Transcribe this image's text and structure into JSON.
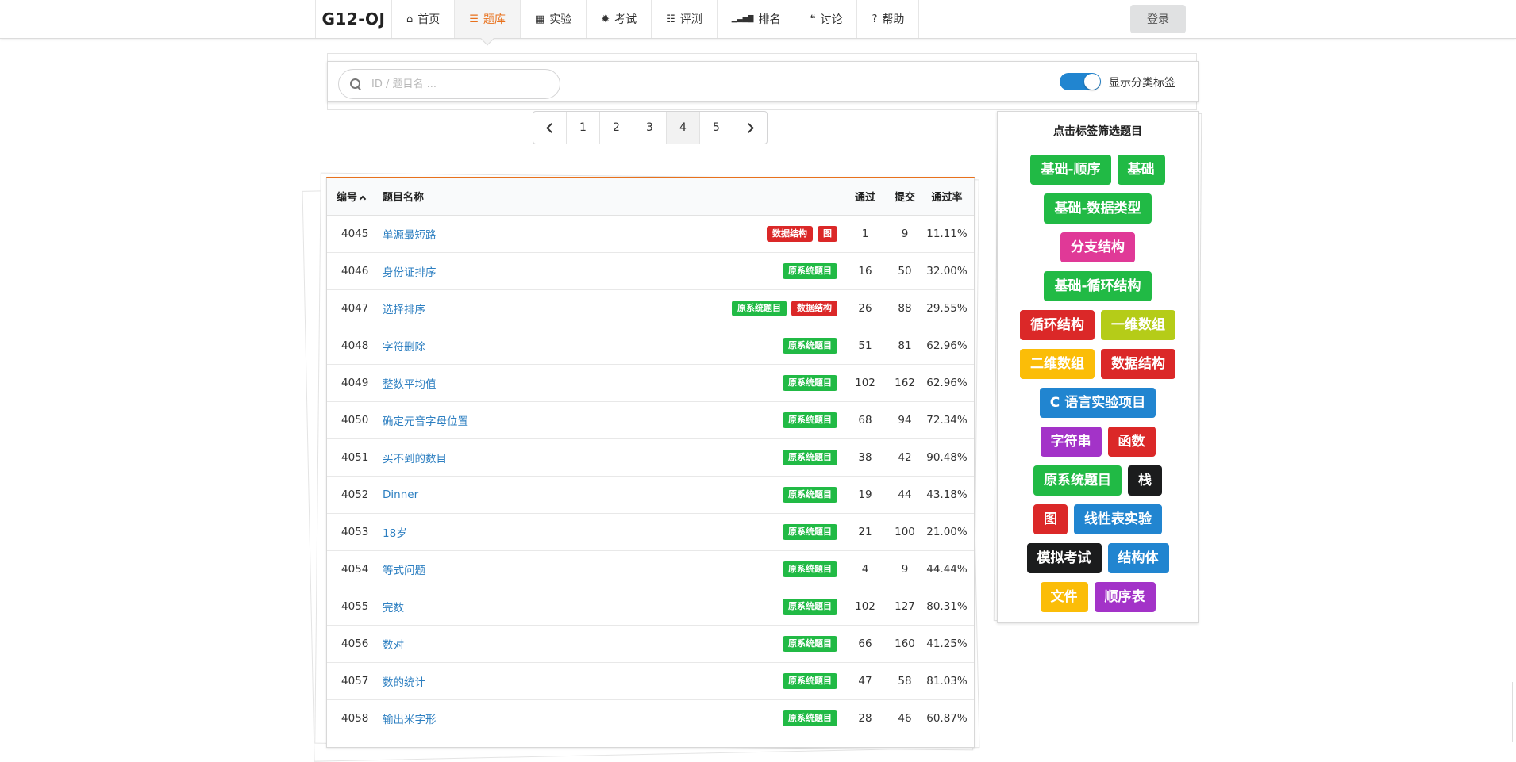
{
  "nav": {
    "brand": "G12-OJ",
    "items": [
      {
        "label": "首页",
        "icon": "home-icon",
        "glyph": "⌂"
      },
      {
        "label": "题库",
        "icon": "list-icon",
        "glyph": "☰",
        "active": true
      },
      {
        "label": "实验",
        "icon": "calendar-icon",
        "glyph": "▦"
      },
      {
        "label": "考试",
        "icon": "gear-icon",
        "glyph": "✹"
      },
      {
        "label": "评测",
        "icon": "tasks-icon",
        "glyph": "☷"
      },
      {
        "label": "排名",
        "icon": "signal-icon",
        "glyph": "▁▃▅▇"
      },
      {
        "label": "讨论",
        "icon": "comments-icon",
        "glyph": "❝"
      },
      {
        "label": "帮助",
        "icon": "question-icon",
        "glyph": "?"
      }
    ],
    "login": "登录"
  },
  "search": {
    "placeholder": "ID / 题目名 ..."
  },
  "toggle": {
    "label": "显示分类标签",
    "on": true
  },
  "pagination": {
    "pages": [
      "1",
      "2",
      "3",
      "4",
      "5"
    ],
    "current": "4"
  },
  "table": {
    "headers": {
      "id": "编号",
      "name": "题目名称",
      "pass": "通过",
      "submit": "提交",
      "rate": "通过率"
    },
    "rows": [
      {
        "id": "4045",
        "name": "单源最短路",
        "tags": [
          {
            "label": "数据结构",
            "color": "#db2828"
          },
          {
            "label": "图",
            "color": "#db2828"
          }
        ],
        "pass": "1",
        "submit": "9",
        "rate": "11.11%"
      },
      {
        "id": "4046",
        "name": "身份证排序",
        "tags": [
          {
            "label": "原系统题目",
            "color": "#21ba45"
          }
        ],
        "pass": "16",
        "submit": "50",
        "rate": "32.00%"
      },
      {
        "id": "4047",
        "name": "选择排序",
        "tags": [
          {
            "label": "原系统题目",
            "color": "#21ba45"
          },
          {
            "label": "数据结构",
            "color": "#db2828"
          }
        ],
        "pass": "26",
        "submit": "88",
        "rate": "29.55%"
      },
      {
        "id": "4048",
        "name": "字符删除",
        "tags": [
          {
            "label": "原系统题目",
            "color": "#21ba45"
          }
        ],
        "pass": "51",
        "submit": "81",
        "rate": "62.96%"
      },
      {
        "id": "4049",
        "name": "整数平均值",
        "tags": [
          {
            "label": "原系统题目",
            "color": "#21ba45"
          }
        ],
        "pass": "102",
        "submit": "162",
        "rate": "62.96%"
      },
      {
        "id": "4050",
        "name": "确定元音字母位置",
        "tags": [
          {
            "label": "原系统题目",
            "color": "#21ba45"
          }
        ],
        "pass": "68",
        "submit": "94",
        "rate": "72.34%"
      },
      {
        "id": "4051",
        "name": "买不到的数目",
        "tags": [
          {
            "label": "原系统题目",
            "color": "#21ba45"
          }
        ],
        "pass": "38",
        "submit": "42",
        "rate": "90.48%"
      },
      {
        "id": "4052",
        "name": "Dinner",
        "tags": [
          {
            "label": "原系统题目",
            "color": "#21ba45"
          }
        ],
        "pass": "19",
        "submit": "44",
        "rate": "43.18%"
      },
      {
        "id": "4053",
        "name": "18岁",
        "tags": [
          {
            "label": "原系统题目",
            "color": "#21ba45"
          }
        ],
        "pass": "21",
        "submit": "100",
        "rate": "21.00%"
      },
      {
        "id": "4054",
        "name": "等式问题",
        "tags": [
          {
            "label": "原系统题目",
            "color": "#21ba45"
          }
        ],
        "pass": "4",
        "submit": "9",
        "rate": "44.44%"
      },
      {
        "id": "4055",
        "name": "完数",
        "tags": [
          {
            "label": "原系统题目",
            "color": "#21ba45"
          }
        ],
        "pass": "102",
        "submit": "127",
        "rate": "80.31%"
      },
      {
        "id": "4056",
        "name": "数对",
        "tags": [
          {
            "label": "原系统题目",
            "color": "#21ba45"
          }
        ],
        "pass": "66",
        "submit": "160",
        "rate": "41.25%"
      },
      {
        "id": "4057",
        "name": "数的统计",
        "tags": [
          {
            "label": "原系统题目",
            "color": "#21ba45"
          }
        ],
        "pass": "47",
        "submit": "58",
        "rate": "81.03%"
      },
      {
        "id": "4058",
        "name": "输出米字形",
        "tags": [
          {
            "label": "原系统题目",
            "color": "#21ba45"
          }
        ],
        "pass": "28",
        "submit": "46",
        "rate": "60.87%"
      }
    ]
  },
  "tag_panel": {
    "title": "点击标签筛选题目",
    "rows": [
      [
        {
          "label": "基础-顺序",
          "color": "#21ba45"
        },
        {
          "label": "基础",
          "color": "#21ba45"
        }
      ],
      [
        {
          "label": "基础-数据类型",
          "color": "#21ba45"
        }
      ],
      [
        {
          "label": "分支结构",
          "color": "#e03997"
        }
      ],
      [
        {
          "label": "基础-循环结构",
          "color": "#21ba45"
        }
      ],
      [
        {
          "label": "循环结构",
          "color": "#db2828"
        },
        {
          "label": "一维数组",
          "color": "#b5cc18"
        }
      ],
      [
        {
          "label": "二维数组",
          "color": "#fbbd08"
        },
        {
          "label": "数据结构",
          "color": "#db2828"
        }
      ],
      [
        {
          "label": "C 语言实验项目",
          "color": "#2185d0"
        }
      ],
      [
        {
          "label": "字符串",
          "color": "#a333c8"
        },
        {
          "label": "函数",
          "color": "#db2828"
        }
      ],
      [
        {
          "label": "原系统题目",
          "color": "#21ba45"
        },
        {
          "label": "栈",
          "color": "#1b1c1d"
        }
      ],
      [
        {
          "label": "图",
          "color": "#db2828"
        },
        {
          "label": "线性表实验",
          "color": "#2185d0"
        }
      ],
      [
        {
          "label": "模拟考试",
          "color": "#1b1c1d"
        },
        {
          "label": "结构体",
          "color": "#2185d0"
        }
      ],
      [
        {
          "label": "文件",
          "color": "#fbbd08"
        },
        {
          "label": "顺序表",
          "color": "#a333c8"
        }
      ]
    ]
  }
}
